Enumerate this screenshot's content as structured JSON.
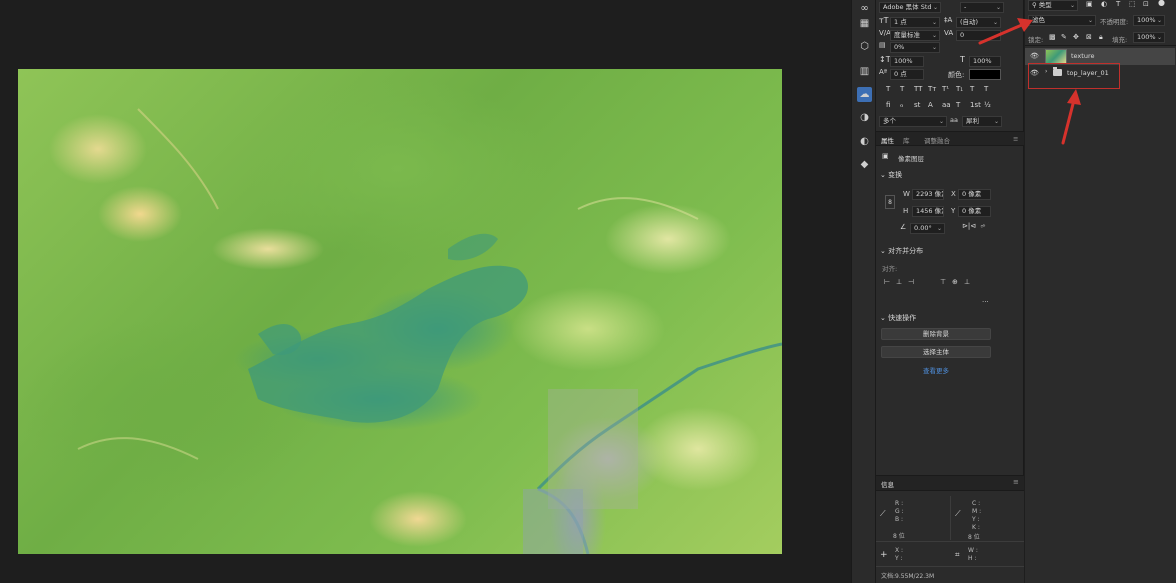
{
  "character": {
    "font_family": "Adobe 黑体 Std",
    "font_style": "-",
    "font_size": "1 点",
    "leading": "(自动)",
    "kerning": "度量标准",
    "tracking": "0",
    "tsume": "0%",
    "vertical_scale": "100%",
    "horizontal_scale": "100%",
    "baseline_shift": "0 点",
    "color_label": "颜色:",
    "color_value": "#000000",
    "language": "多个",
    "anti_alias_icon": "aa",
    "anti_alias": "犀利",
    "style_buttons": [
      "T",
      "T",
      "TT",
      "Tт",
      "T¹",
      "T₁",
      "T",
      "T"
    ],
    "opentype_buttons": [
      "fi",
      "ℴ",
      "st",
      "A",
      "aa",
      "T",
      "1st",
      "½"
    ]
  },
  "properties": {
    "tabs": [
      "属性",
      "库",
      "调整融合"
    ],
    "kind": "像素图层",
    "transform": {
      "title": "变换",
      "w_label": "W",
      "w": "2293 像素",
      "x_label": "X",
      "x": "0 像素",
      "h_label": "H",
      "h": "1456 像素",
      "y_label": "Y",
      "y": "0 像素",
      "angle": "0.00°"
    },
    "align": {
      "title": "对齐并分布",
      "sub": "对齐:",
      "more": "..."
    },
    "quick": {
      "title": "快速操作",
      "remove_bg": "删除背景",
      "select_subject": "选择主体",
      "learn_more": "查看更多"
    }
  },
  "info": {
    "tab": "信息",
    "rgb": [
      "R :",
      "G :",
      "B :"
    ],
    "rgb_bits": "8 位",
    "cmyk": [
      "C :",
      "M :",
      "Y :",
      "K :"
    ],
    "cmyk_bits": "8 位",
    "xy": [
      "X :",
      "Y :"
    ],
    "wh": [
      "W :",
      "H :"
    ],
    "doc": "文档:9.55M/22.3M"
  },
  "layers": {
    "filter_kind": "类型",
    "blend_mode": "滤色",
    "opacity_label": "不透明度:",
    "opacity": "100%",
    "lock_label": "锁定:",
    "fill_label": "填充:",
    "fill": "100%",
    "items": [
      {
        "name": "texture",
        "type": "pixel",
        "selected": true
      },
      {
        "name": "top_layer_01",
        "type": "group",
        "selected": false
      }
    ]
  },
  "colors": {
    "accent": "#3d6fb4",
    "annotation": "#d6322c",
    "link": "#4f8fdc"
  }
}
